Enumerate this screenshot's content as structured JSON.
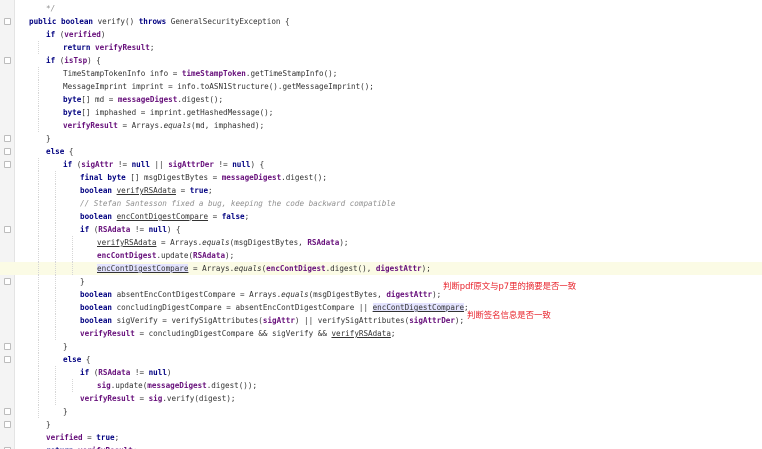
{
  "lines": [
    {
      "indent": 2,
      "tokens": [
        {
          "t": "*/",
          "c": "cm"
        }
      ]
    },
    {
      "indent": 1,
      "tokens": [
        {
          "t": "public boolean ",
          "c": "kw"
        },
        {
          "t": "verify() "
        },
        {
          "t": "throws ",
          "c": "kw"
        },
        {
          "t": "GeneralSecurityException {"
        }
      ]
    },
    {
      "indent": 2,
      "tokens": [
        {
          "t": "if ",
          "c": "kw"
        },
        {
          "t": "("
        },
        {
          "t": "verified",
          "c": "fld"
        },
        {
          "t": ")"
        }
      ]
    },
    {
      "indent": 3,
      "tokens": [
        {
          "t": "return ",
          "c": "kw"
        },
        {
          "t": "verifyResult",
          "c": "fld"
        },
        {
          "t": ";"
        }
      ]
    },
    {
      "indent": 2,
      "tokens": [
        {
          "t": "if ",
          "c": "kw"
        },
        {
          "t": "("
        },
        {
          "t": "isTsp",
          "c": "fld"
        },
        {
          "t": ") {"
        }
      ]
    },
    {
      "indent": 3,
      "tokens": [
        {
          "t": "TimeStampTokenInfo info = "
        },
        {
          "t": "timeStampToken",
          "c": "fld"
        },
        {
          "t": ".getTimeStampInfo();"
        }
      ]
    },
    {
      "indent": 3,
      "tokens": [
        {
          "t": "MessageImprint imprint = info.toASN1Structure().getMessageImprint();"
        }
      ]
    },
    {
      "indent": 3,
      "tokens": [
        {
          "t": "byte",
          "c": "kw"
        },
        {
          "t": "[] md = "
        },
        {
          "t": "messageDigest",
          "c": "fld"
        },
        {
          "t": ".digest();"
        }
      ]
    },
    {
      "indent": 3,
      "tokens": [
        {
          "t": "byte",
          "c": "kw"
        },
        {
          "t": "[] imphashed = imprint.getHashedMessage();"
        }
      ]
    },
    {
      "indent": 3,
      "tokens": [
        {
          "t": "verifyResult",
          "c": "fld"
        },
        {
          "t": " = Arrays."
        },
        {
          "t": "equals",
          "c": "it"
        },
        {
          "t": "(md, imphashed);"
        }
      ]
    },
    {
      "indent": 2,
      "tokens": [
        {
          "t": "}"
        }
      ]
    },
    {
      "indent": 2,
      "tokens": [
        {
          "t": "else ",
          "c": "kw"
        },
        {
          "t": "{"
        }
      ]
    },
    {
      "indent": 3,
      "tokens": [
        {
          "t": "if ",
          "c": "kw"
        },
        {
          "t": "("
        },
        {
          "t": "sigAttr",
          "c": "fld"
        },
        {
          "t": " != "
        },
        {
          "t": "null",
          "c": "kw"
        },
        {
          "t": " || "
        },
        {
          "t": "sigAttrDer",
          "c": "fld"
        },
        {
          "t": " != "
        },
        {
          "t": "null",
          "c": "kw"
        },
        {
          "t": ") {"
        }
      ]
    },
    {
      "indent": 4,
      "tokens": [
        {
          "t": "final byte ",
          "c": "kw"
        },
        {
          "t": "[] msgDigestBytes = "
        },
        {
          "t": "messageDigest",
          "c": "fld"
        },
        {
          "t": ".digest();"
        }
      ]
    },
    {
      "indent": 4,
      "tokens": [
        {
          "t": "boolean ",
          "c": "kw"
        },
        {
          "t": "verifyRSAdata",
          "c": "ul"
        },
        {
          "t": " = "
        },
        {
          "t": "true",
          "c": "kw"
        },
        {
          "t": ";"
        }
      ]
    },
    {
      "indent": 4,
      "tokens": [
        {
          "t": "// Stefan Santesson fixed a bug, keeping the code backward compatible",
          "c": "cm"
        }
      ]
    },
    {
      "indent": 4,
      "tokens": [
        {
          "t": "boolean ",
          "c": "kw"
        },
        {
          "t": "encContDigestCompare",
          "c": "ul"
        },
        {
          "t": " = "
        },
        {
          "t": "false",
          "c": "kw"
        },
        {
          "t": ";"
        }
      ]
    },
    {
      "indent": 4,
      "tokens": [
        {
          "t": "if ",
          "c": "kw"
        },
        {
          "t": "("
        },
        {
          "t": "RSAdata",
          "c": "fld"
        },
        {
          "t": " != "
        },
        {
          "t": "null",
          "c": "kw"
        },
        {
          "t": ") {"
        }
      ]
    },
    {
      "indent": 5,
      "tokens": [
        {
          "t": "verifyRSAdata",
          "c": "ul"
        },
        {
          "t": " = Arrays."
        },
        {
          "t": "equals",
          "c": "it"
        },
        {
          "t": "(msgDigestBytes, "
        },
        {
          "t": "RSAdata",
          "c": "fld"
        },
        {
          "t": ");"
        }
      ]
    },
    {
      "indent": 5,
      "tokens": [
        {
          "t": "encContDigest",
          "c": "fld"
        },
        {
          "t": ".update("
        },
        {
          "t": "RSAdata",
          "c": "fld"
        },
        {
          "t": ");"
        }
      ]
    },
    {
      "indent": 5,
      "highlight": true,
      "tokens": [
        {
          "t": "encContDigestCompare",
          "c": "ul sel"
        },
        {
          "t": " = Arrays."
        },
        {
          "t": "equals",
          "c": "it"
        },
        {
          "t": "("
        },
        {
          "t": "encContDigest",
          "c": "fld"
        },
        {
          "t": ".digest(), "
        },
        {
          "t": "digestAttr",
          "c": "fld"
        },
        {
          "t": ");"
        }
      ]
    },
    {
      "indent": 4,
      "tokens": [
        {
          "t": "}"
        }
      ]
    },
    {
      "indent": 4,
      "tokens": [
        {
          "t": "boolean ",
          "c": "kw"
        },
        {
          "t": "absentEncContDigestCompare = Arrays."
        },
        {
          "t": "equals",
          "c": "it"
        },
        {
          "t": "(msgDigestBytes, "
        },
        {
          "t": "digestAttr",
          "c": "fld"
        },
        {
          "t": ");"
        }
      ]
    },
    {
      "indent": 4,
      "tokens": [
        {
          "t": "boolean ",
          "c": "kw"
        },
        {
          "t": "concludingDigestCompare = absentEncContDigestCompare || "
        },
        {
          "t": "encContDigestCompare",
          "c": "ul sel"
        },
        {
          "t": ";"
        }
      ]
    },
    {
      "indent": 4,
      "tokens": [
        {
          "t": "boolean ",
          "c": "kw"
        },
        {
          "t": "sigVerify = verifySigAttributes("
        },
        {
          "t": "sigAttr",
          "c": "fld"
        },
        {
          "t": ") || verifySigAttributes("
        },
        {
          "t": "sigAttrDer",
          "c": "fld"
        },
        {
          "t": ");"
        }
      ]
    },
    {
      "indent": 4,
      "tokens": [
        {
          "t": "verifyResult",
          "c": "fld"
        },
        {
          "t": " = concludingDigestCompare && sigVerify && "
        },
        {
          "t": "verifyRSAdata",
          "c": "ul"
        },
        {
          "t": ";"
        }
      ]
    },
    {
      "indent": 3,
      "tokens": [
        {
          "t": "}"
        }
      ]
    },
    {
      "indent": 3,
      "tokens": [
        {
          "t": "else ",
          "c": "kw"
        },
        {
          "t": "{"
        }
      ]
    },
    {
      "indent": 4,
      "tokens": [
        {
          "t": "if ",
          "c": "kw"
        },
        {
          "t": "("
        },
        {
          "t": "RSAdata",
          "c": "fld"
        },
        {
          "t": " != "
        },
        {
          "t": "null",
          "c": "kw"
        },
        {
          "t": ")"
        }
      ]
    },
    {
      "indent": 5,
      "tokens": [
        {
          "t": "sig",
          "c": "fld"
        },
        {
          "t": ".update("
        },
        {
          "t": "messageDigest",
          "c": "fld"
        },
        {
          "t": ".digest());"
        }
      ]
    },
    {
      "indent": 4,
      "tokens": [
        {
          "t": "verifyResult",
          "c": "fld"
        },
        {
          "t": " = "
        },
        {
          "t": "sig",
          "c": "fld"
        },
        {
          "t": ".verify(digest);"
        }
      ]
    },
    {
      "indent": 3,
      "tokens": [
        {
          "t": "}"
        }
      ]
    },
    {
      "indent": 2,
      "tokens": [
        {
          "t": "}"
        }
      ]
    },
    {
      "indent": 2,
      "tokens": [
        {
          "t": "verified",
          "c": "fld"
        },
        {
          "t": " = "
        },
        {
          "t": "true",
          "c": "kw"
        },
        {
          "t": ";"
        }
      ]
    },
    {
      "indent": 2,
      "tokens": [
        {
          "t": "return ",
          "c": "kw"
        },
        {
          "t": "verifyResult",
          "c": "fld"
        },
        {
          "t": ";"
        }
      ]
    }
  ],
  "annotations": {
    "digest_note": "判断pdf原文与p7里的摘要是否一致",
    "signature_note": "判断签名信息是否一致"
  },
  "colors": {
    "keyword": "#000080",
    "field": "#660e7a",
    "comment": "#909090",
    "annotation": "#e8212a",
    "line_highlight": "#fbfbe5"
  }
}
